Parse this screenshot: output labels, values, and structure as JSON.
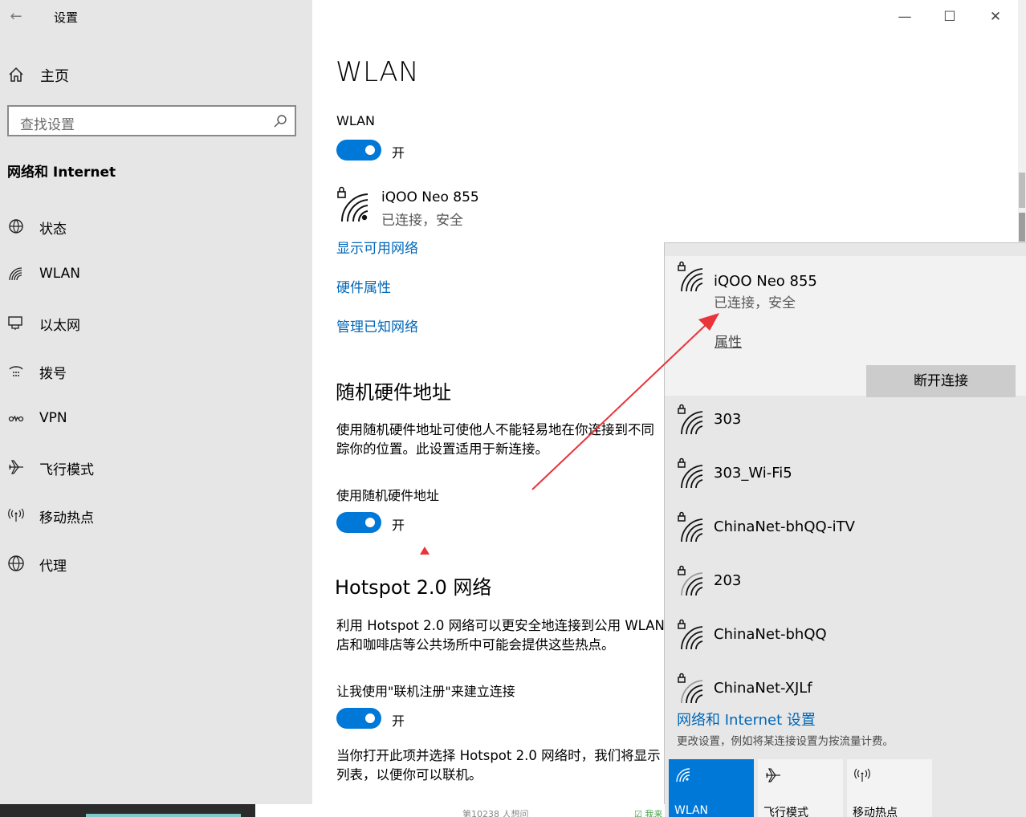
{
  "window": {
    "title": "设置",
    "minimize": "—",
    "maximize": "☐",
    "close": "✕"
  },
  "sidebar": {
    "home": "主页",
    "search_placeholder": "查找设置",
    "section": "网络和 Internet",
    "items": [
      {
        "label": "状态",
        "icon": "globe-status-icon"
      },
      {
        "label": "WLAN",
        "icon": "wifi-icon"
      },
      {
        "label": "以太网",
        "icon": "ethernet-icon"
      },
      {
        "label": "拨号",
        "icon": "dialup-icon"
      },
      {
        "label": "VPN",
        "icon": "vpn-icon"
      },
      {
        "label": "飞行模式",
        "icon": "airplane-icon"
      },
      {
        "label": "移动热点",
        "icon": "hotspot-icon"
      },
      {
        "label": "代理",
        "icon": "globe-icon"
      }
    ]
  },
  "main": {
    "title": "WLAN",
    "wlan_label": "WLAN",
    "wlan_toggle": "开",
    "current_network": {
      "name": "iQOO Neo 855",
      "status": "已连接，安全"
    },
    "links": [
      "显示可用网络",
      "硬件属性",
      "管理已知网络"
    ],
    "random_mac": {
      "heading": "随机硬件地址",
      "desc_line1": "使用随机硬件地址可使他人不能轻易地在你连接到不同",
      "desc_line2": "踪你的位置。此设置适用于新连接。",
      "toggle_label": "使用随机硬件地址",
      "toggle_state": "开"
    },
    "hotspot": {
      "heading": "Hotspot 2.0 网络",
      "desc_line1": "利用 Hotspot 2.0 网络可以更安全地连接到公用 WLAN",
      "desc_line2": "店和咖啡店等公共场所中可能会提供这些热点。",
      "toggle_label": "让我使用\"联机注册\"来建立连接",
      "toggle_state": "开",
      "tail_line1": "当你打开此项并选择 Hotspot 2.0 网络时，我们将显示",
      "tail_line2": "列表，以便你可以联机。"
    }
  },
  "flyout": {
    "current": {
      "name": "iQOO Neo 855",
      "status": "已连接，安全",
      "properties": "属性",
      "disconnect": "断开连接"
    },
    "networks": [
      "303",
      "303_Wi-Fi5",
      "ChinaNet-bhQQ-iTV",
      "203",
      "ChinaNet-bhQQ",
      "ChinaNet-XJLf"
    ],
    "settings_link": "网络和 Internet 设置",
    "settings_sub": "更改设置，例如将某连接设置为按流量计费。",
    "quick_actions": [
      {
        "label": "WLAN",
        "active": true
      },
      {
        "label": "飞行模式",
        "active": false
      },
      {
        "label": "移动热点",
        "active": false
      }
    ]
  },
  "taskbar": {
    "text1": "第10238 人想问",
    "text2": "☑ 我来"
  },
  "colors": {
    "accent": "#0078d7",
    "link": "#0067b8",
    "annotation": "#e8343a"
  }
}
